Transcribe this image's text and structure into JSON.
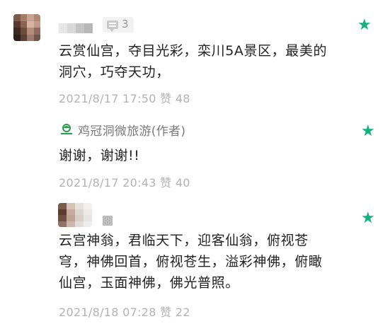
{
  "comments": [
    {
      "content": "云赏仙宫，夺目光彩，栾川5A景区，最美的洞穴，巧夺天功，",
      "date": "2021/8/17 17:50",
      "like_label": "赞",
      "likes": "48",
      "reply_count": "3"
    },
    {
      "author": "鸡冠洞微旅游(作者)",
      "content": "谢谢，谢谢!!",
      "date": "2021/8/17 20:43",
      "like_label": "赞",
      "likes": "40"
    },
    {
      "content": "云宫神翁，君临天下，迎客仙翁，俯视苍穹，神佛回首，俯视苍生，溢彩神佛，俯瞰仙宫，玉面神佛，佛光普照。",
      "date": "2021/8/18 07:28",
      "like_label": "赞",
      "likes": "22"
    }
  ],
  "colors": {
    "star": "#16b27d",
    "meta": "#b3b3b3",
    "text": "#222222",
    "author": "#7a7a7a"
  },
  "icons": {
    "star": "star-icon",
    "reply": "reply-icon",
    "logo": "author-logo-icon"
  }
}
